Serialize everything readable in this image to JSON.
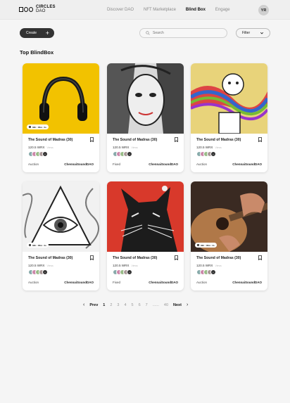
{
  "brand": {
    "name_line1": "CIRCLES",
    "name_line2": "DAO"
  },
  "nav": [
    {
      "label": "Discover DAO"
    },
    {
      "label": "NFT Marketplace"
    },
    {
      "label": "Blind Box"
    },
    {
      "label": "Engage"
    }
  ],
  "user": {
    "initials": "YR"
  },
  "toolbar": {
    "create_label": "Create",
    "search_placeholder": "Search",
    "filter_label": "Filter"
  },
  "section_title": "Top BlindBox",
  "cards": [
    {
      "title": "The Sound of Madras (30)",
      "price": "120.5 WRX",
      "sub": "Views",
      "sale": "Auction",
      "by": "ChennaiSoundDAO",
      "timer": "02h : 35m : 4s",
      "owners_more": "+"
    },
    {
      "title": "The Sound of Madras (30)",
      "price": "120.5 WRX",
      "sub": "Views",
      "sale": "Fixed",
      "by": "ChennaiSoundDAO",
      "timer": "",
      "owners_more": "+"
    },
    {
      "title": "The Sound of Madras (30)",
      "price": "120.5 WRX",
      "sub": "Views",
      "sale": "Auction",
      "by": "ChennaiSoundDAO",
      "timer": "",
      "owners_more": "+"
    },
    {
      "title": "The Sound of Madras (30)",
      "price": "120.5 WRX",
      "sub": "Views",
      "sale": "Auction",
      "by": "ChennaiSoundDAO",
      "timer": "02h : 35m : 4s",
      "owners_more": "+"
    },
    {
      "title": "The Sound of Madras (30)",
      "price": "120.5 WRX",
      "sub": "Views",
      "sale": "Fixed",
      "by": "ChennaiSoundDAO",
      "timer": "",
      "owners_more": "+"
    },
    {
      "title": "The Sound of Madras (30)",
      "price": "120.5 WRX",
      "sub": "Views",
      "sale": "Auction",
      "by": "ChennaiSoundDAO",
      "timer": "02h : 35m : 4s",
      "owners_more": "+"
    }
  ],
  "pagination": {
    "prev": "Prev",
    "next": "Next",
    "pages": [
      "1",
      "2",
      "3",
      "4",
      "5",
      "6",
      "7"
    ],
    "ellipsis": "......",
    "last": "40",
    "current": "1"
  },
  "colors": {
    "accent": "#333333",
    "thumb_yellow": "#f2c200"
  }
}
